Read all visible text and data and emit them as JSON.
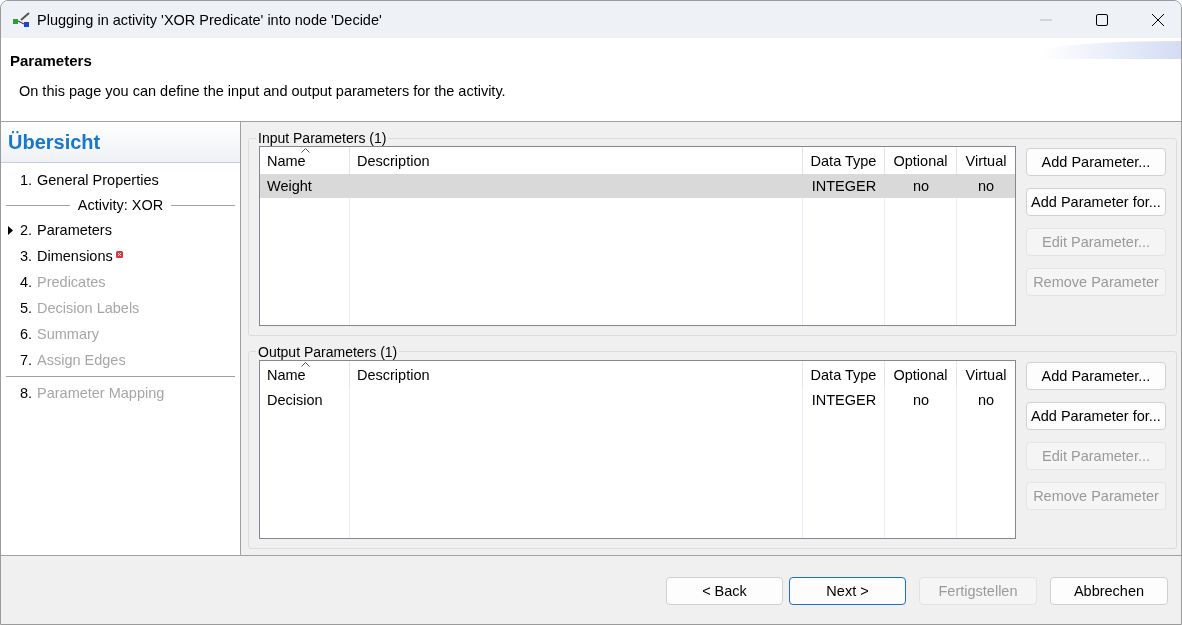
{
  "window": {
    "title": "Plugging in activity 'XOR Predicate' into node 'Decide'",
    "controls": [
      {
        "kind": "minimize",
        "disabled": true
      },
      {
        "kind": "maximize",
        "disabled": false
      },
      {
        "kind": "close",
        "disabled": false
      }
    ]
  },
  "header": {
    "title": "Parameters",
    "description": "On this page you can define the input and output parameters for the activity."
  },
  "sidebar": {
    "title": "Übersicht",
    "items": [
      {
        "kind": "step",
        "number": "1.",
        "label": "General Properties",
        "selected": false,
        "disabled": false,
        "error": false
      },
      {
        "kind": "section",
        "label": "Activity: XOR"
      },
      {
        "kind": "step",
        "number": "2.",
        "label": "Parameters",
        "selected": true,
        "disabled": false,
        "error": false
      },
      {
        "kind": "step",
        "number": "3.",
        "label": "Dimensions",
        "selected": false,
        "disabled": false,
        "error": true
      },
      {
        "kind": "step",
        "number": "4.",
        "label": "Predicates",
        "selected": false,
        "disabled": true,
        "error": false
      },
      {
        "kind": "step",
        "number": "5.",
        "label": "Decision Labels",
        "selected": false,
        "disabled": true,
        "error": false
      },
      {
        "kind": "step",
        "number": "6.",
        "label": "Summary",
        "selected": false,
        "disabled": true,
        "error": false
      },
      {
        "kind": "step",
        "number": "7.",
        "label": "Assign Edges",
        "selected": false,
        "disabled": true,
        "error": false
      },
      {
        "kind": "divider"
      },
      {
        "kind": "step",
        "number": "8.",
        "label": "Parameter Mapping",
        "selected": false,
        "disabled": true,
        "error": false
      }
    ]
  },
  "groups": [
    {
      "title": "Input Parameters (1)",
      "columns": [
        {
          "label": "Name",
          "sorted": true
        },
        {
          "label": "Description",
          "sorted": false
        },
        {
          "label": "Data Type",
          "sorted": false
        },
        {
          "label": "Optional",
          "sorted": false
        },
        {
          "label": "Virtual",
          "sorted": false
        }
      ],
      "rows": [
        {
          "cells": [
            "Weight",
            "",
            "INTEGER",
            "no",
            "no"
          ],
          "selected": true
        }
      ],
      "buttons": [
        {
          "label": "Add Parameter...",
          "disabled": false
        },
        {
          "label": "Add Parameter for...",
          "disabled": false
        },
        {
          "label": "Edit Parameter...",
          "disabled": true
        },
        {
          "label": "Remove Parameter",
          "disabled": true
        }
      ]
    },
    {
      "title": "Output Parameters (1)",
      "columns": [
        {
          "label": "Name",
          "sorted": true
        },
        {
          "label": "Description",
          "sorted": false
        },
        {
          "label": "Data Type",
          "sorted": false
        },
        {
          "label": "Optional",
          "sorted": false
        },
        {
          "label": "Virtual",
          "sorted": false
        }
      ],
      "rows": [
        {
          "cells": [
            "Decision",
            "",
            "INTEGER",
            "no",
            "no"
          ],
          "selected": false
        }
      ],
      "buttons": [
        {
          "label": "Add Parameter...",
          "disabled": false
        },
        {
          "label": "Add Parameter for...",
          "disabled": false
        },
        {
          "label": "Edit Parameter...",
          "disabled": true
        },
        {
          "label": "Remove Parameter",
          "disabled": true
        }
      ]
    }
  ],
  "footer_buttons": [
    {
      "label": "< Back",
      "disabled": false,
      "default": false
    },
    {
      "label": "Next >",
      "disabled": false,
      "default": true
    },
    {
      "label": "Fertigstellen",
      "disabled": true,
      "default": false
    },
    {
      "label": "Abbrechen",
      "disabled": false,
      "default": false
    }
  ]
}
